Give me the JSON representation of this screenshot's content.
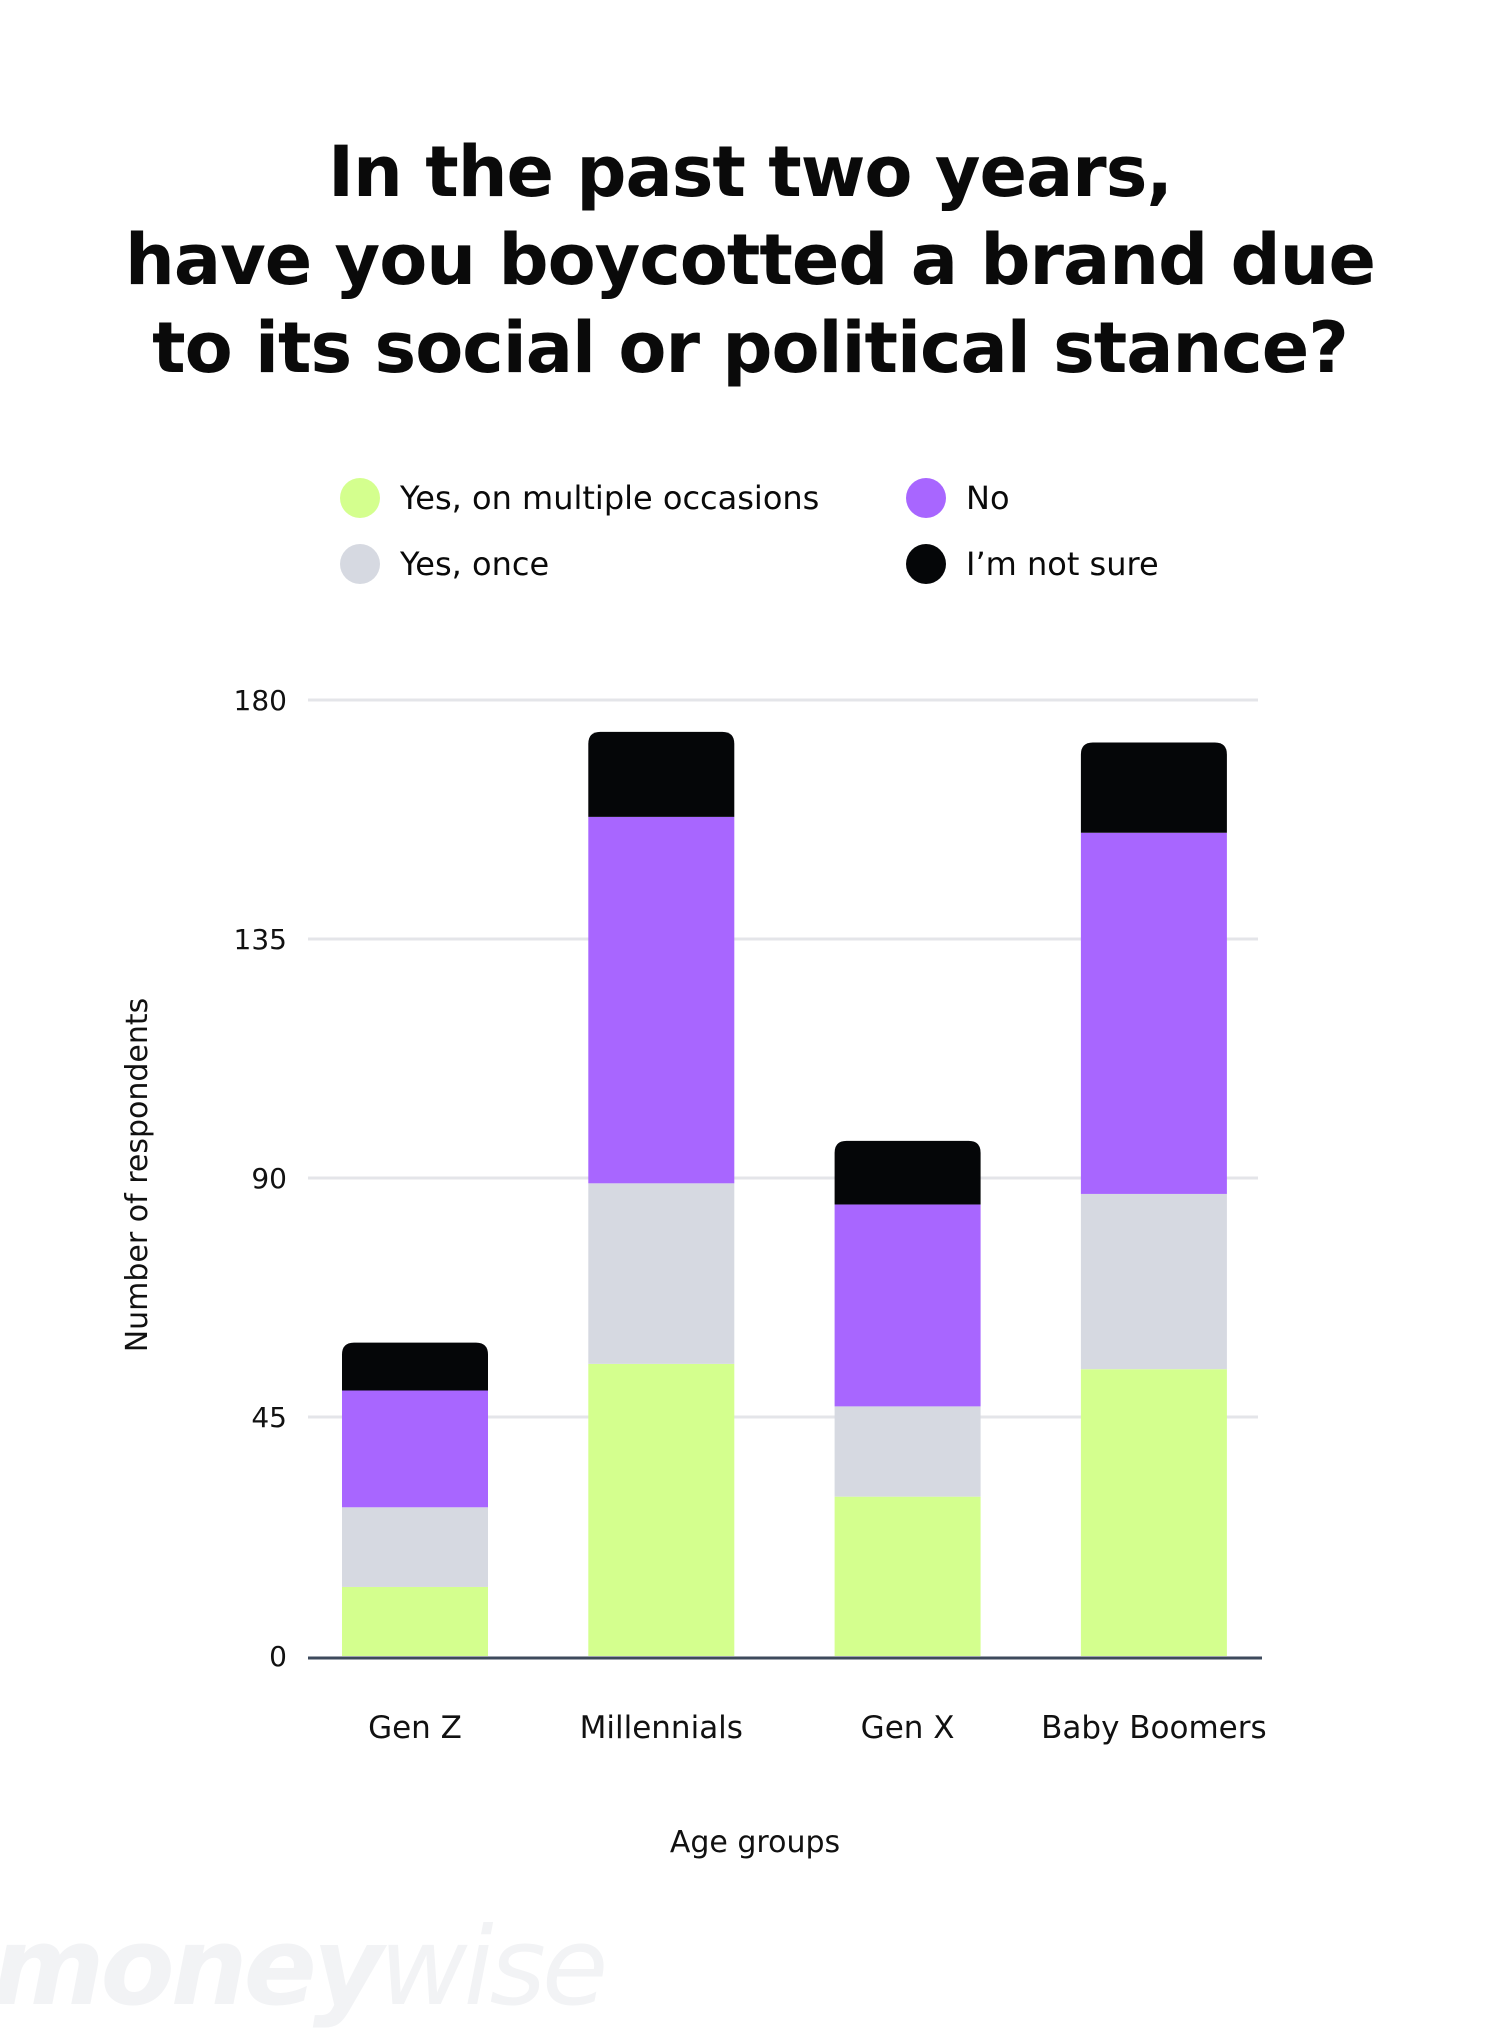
{
  "chart_data": {
    "type": "bar",
    "stacked": true,
    "title_lines": [
      "In the past two years,",
      "have you boycotted a brand due",
      "to its social or political stance?"
    ],
    "xlabel": "Age groups",
    "ylabel": "Number of respondents",
    "categories": [
      "Gen Z",
      "Millennials",
      "Gen X",
      "Baby Boomers"
    ],
    "series": [
      {
        "name": "Yes, on multiple occasions",
        "color": "#D4FF8E",
        "values": [
          13,
          55,
          30,
          54
        ]
      },
      {
        "name": "Yes, once",
        "color": "#D6D9E1",
        "values": [
          15,
          34,
          17,
          33
        ]
      },
      {
        "name": "No",
        "color": "#A866FF",
        "values": [
          22,
          69,
          38,
          68
        ]
      },
      {
        "name": "I’m not sure",
        "color": "#050608",
        "values": [
          9,
          16,
          12,
          17
        ]
      }
    ],
    "ylim": [
      0,
      180
    ],
    "yticks": [
      0,
      45,
      90,
      135,
      180
    ],
    "grid": true,
    "legend_position": "top"
  },
  "legend": {
    "items": [
      {
        "label": "Yes, on multiple occasions",
        "color": "#D4FF8E"
      },
      {
        "label": "Yes, once",
        "color": "#D6D9E1"
      },
      {
        "label": "No",
        "color": "#A866FF"
      },
      {
        "label": "I’m not sure",
        "color": "#050608"
      }
    ]
  },
  "watermark": {
    "bold_part": "money",
    "thin_part": "wise"
  },
  "colors": {
    "gridline": "#E4E5E9",
    "baseline": "#3E4A5C"
  }
}
